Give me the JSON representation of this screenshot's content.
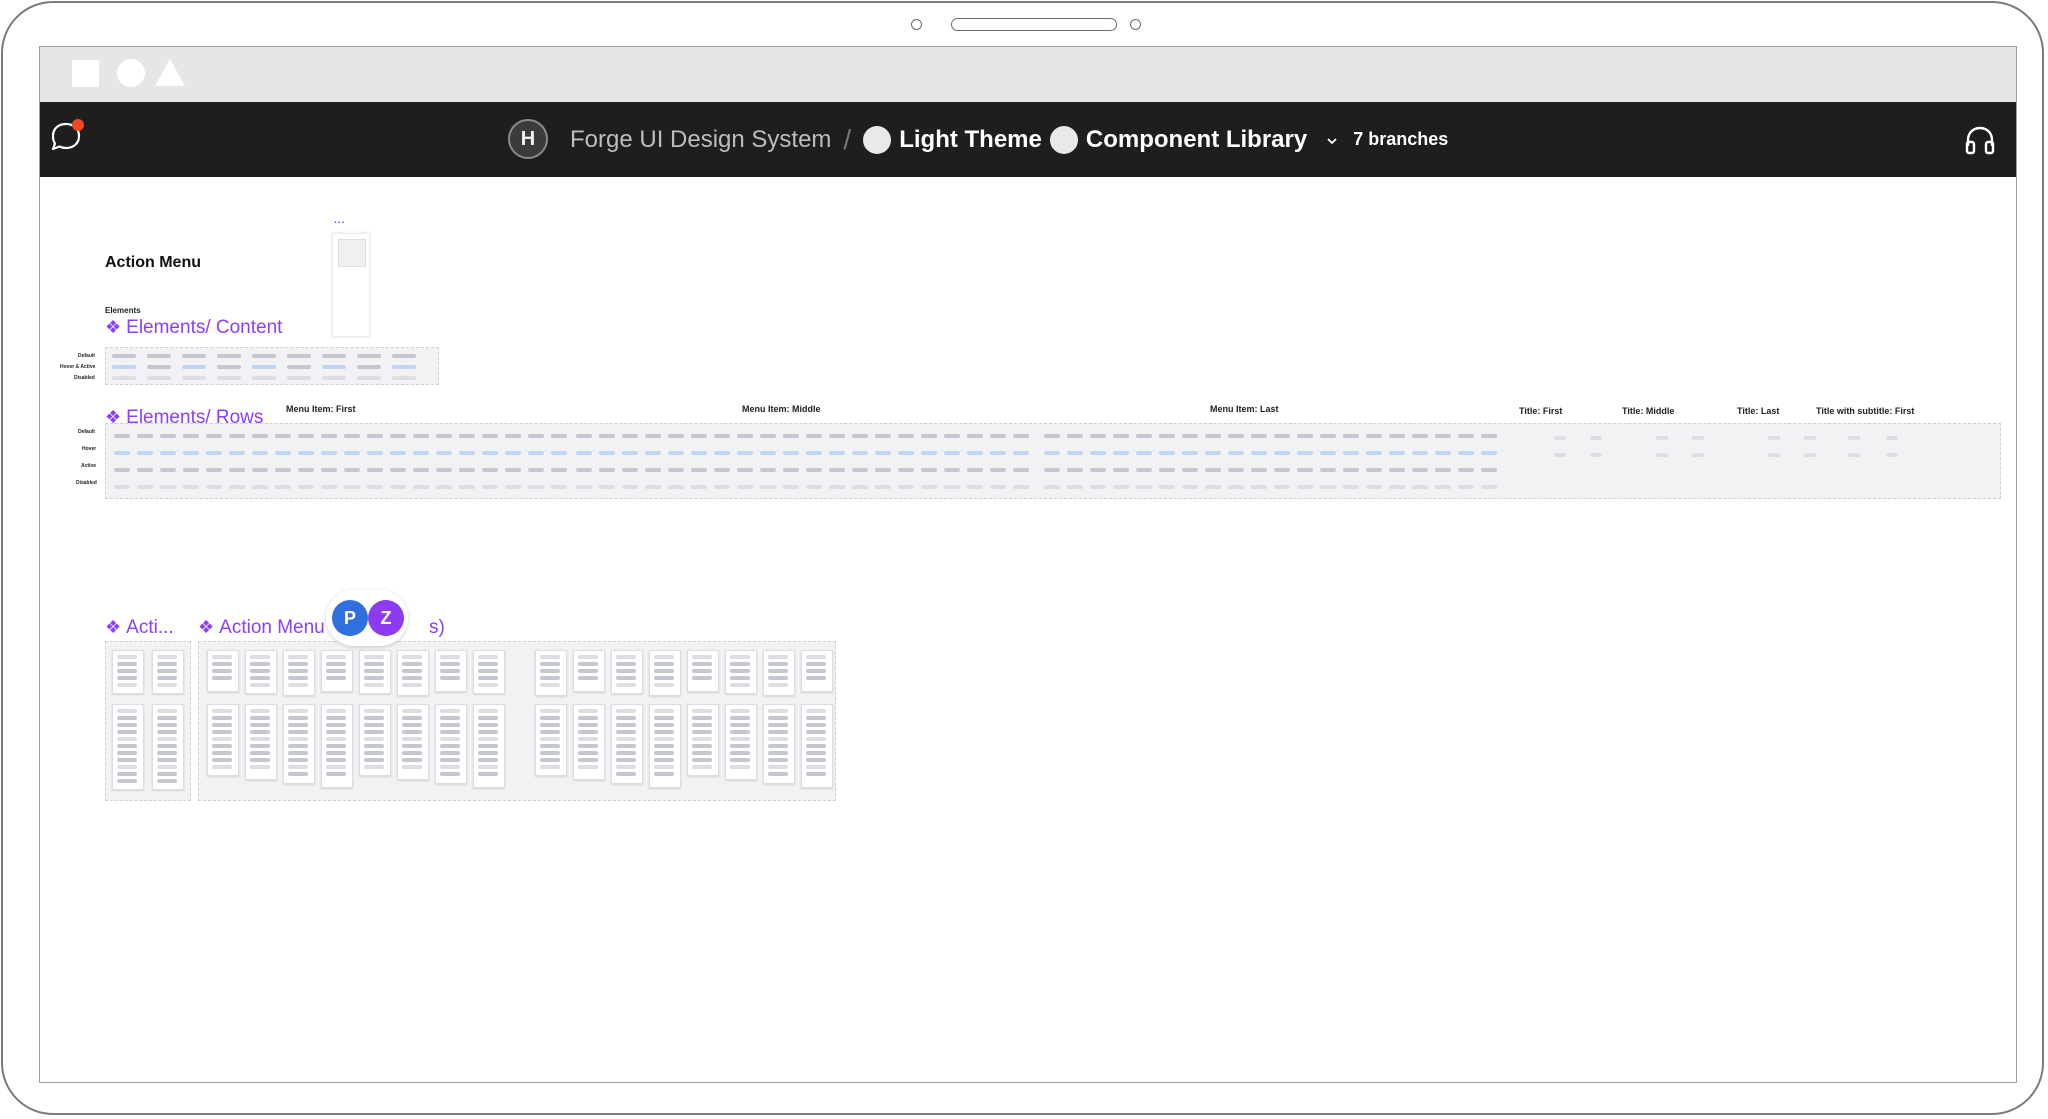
{
  "header": {
    "project_avatar": "H",
    "project_name": "Forge UI Design System",
    "separator": "/",
    "file_1": "Light Theme",
    "file_2": "Component Library",
    "branches": "7 branches",
    "icons": [
      "comment-icon",
      "chevron-down-icon",
      "headphones-icon"
    ],
    "notification_color": "#f24822"
  },
  "canvas": {
    "frame_title": "Action Menu",
    "elements_label": "Elements",
    "thumb_dots": "...",
    "sections": {
      "content": "Elements/ Content",
      "rows": "Elements/ Rows",
      "acti": "Acti...",
      "action_menu": "Action Menu",
      "action_menu_suffix": "s)"
    },
    "content_states": [
      "Default",
      "Hover & Active",
      "Disabled"
    ],
    "row_states": [
      "Default",
      "Hover",
      "Active",
      "Disabled"
    ],
    "row_groups": [
      "Menu Item: First",
      "Menu Item: Middle",
      "Menu Item: Last",
      "Title: First",
      "Title: Middle",
      "Title: Last",
      "Title with subtitle: First"
    ],
    "accent_color": "#8a3ffc"
  },
  "collaborators": [
    "P",
    "Z"
  ]
}
